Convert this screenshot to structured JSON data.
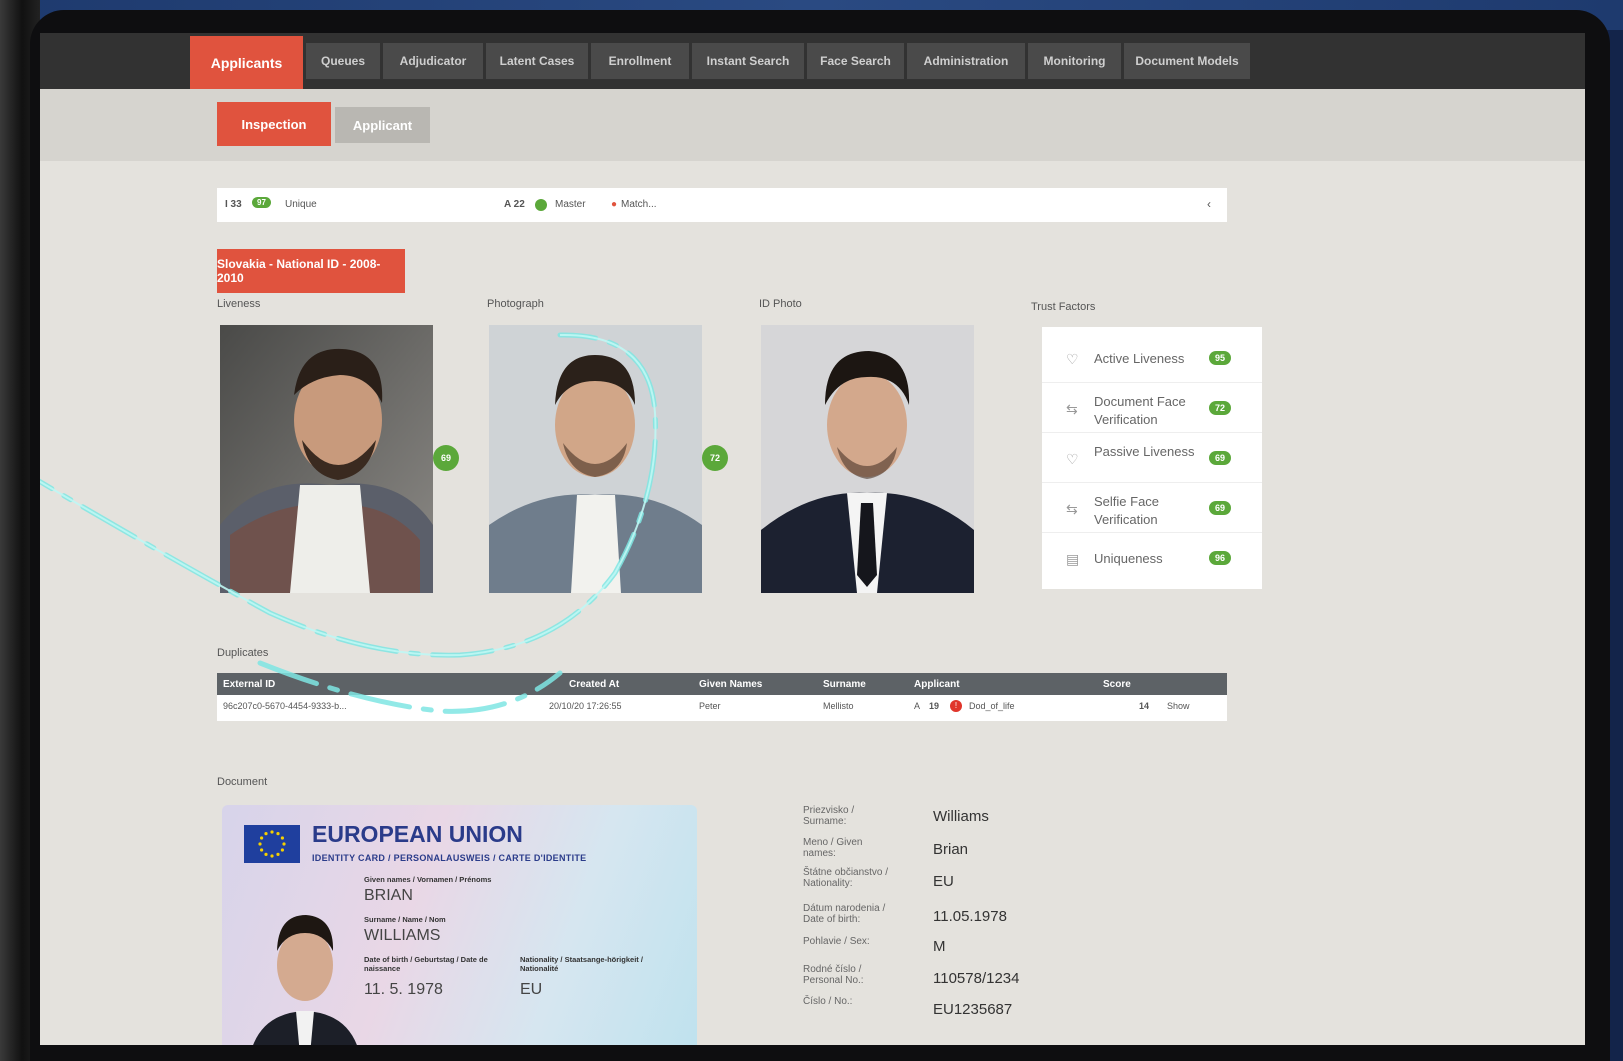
{
  "nav": {
    "tabs": [
      {
        "label": "Applicants",
        "active": true
      },
      {
        "label": "Queues",
        "active": false
      },
      {
        "label": "Adjudicator",
        "active": false
      },
      {
        "label": "Latent Cases",
        "active": false
      },
      {
        "label": "Enrollment",
        "active": false
      },
      {
        "label": "Instant Search",
        "active": false
      },
      {
        "label": "Face Search",
        "active": false
      },
      {
        "label": "Administration",
        "active": false
      },
      {
        "label": "Monitoring",
        "active": false
      },
      {
        "label": "Document Models",
        "active": false
      }
    ]
  },
  "subnav": {
    "inspection_label": "Inspection",
    "applicant_label": "Applicant"
  },
  "summary": {
    "left_count": "I 33",
    "left_badge": "97",
    "left_label": "Unique",
    "mid_count": "A 22",
    "mid_label": "Master",
    "match_label": "Match...",
    "chevron": "‹"
  },
  "document_tag": "Slovakia - National ID - 2008-2010",
  "labels": {
    "liveness": "Liveness",
    "photograph": "Photograph",
    "id_photo": "ID Photo",
    "trust_factors": "Trust Factors",
    "duplicates": "Duplicates",
    "document": "Document"
  },
  "scores": {
    "liveness_to_photo": "69",
    "photo_to_id": "72"
  },
  "trust_factors": [
    {
      "label": "Active Liveness",
      "score": "95",
      "icon": "heart-icon"
    },
    {
      "label": "Document Face Verification",
      "score": "72",
      "icon": "face-compare-icon"
    },
    {
      "label": "Passive Liveness",
      "score": "69",
      "icon": "heart-icon"
    },
    {
      "label": "Selfie Face Verification",
      "score": "69",
      "icon": "face-compare-icon"
    },
    {
      "label": "Uniqueness",
      "score": "96",
      "icon": "unique-icon"
    }
  ],
  "duplicates": {
    "columns": [
      "External ID",
      "Created At",
      "Given Names",
      "Surname",
      "Applicant",
      "Score"
    ],
    "rows": [
      {
        "external_id": "96c207c0-5670-4454-9333-b...",
        "created_at": "20/10/20 17:26:55",
        "given_names": "Peter",
        "surname": "Mellisto",
        "applicant_prefix": "A",
        "applicant_num": "19",
        "applicant_flag": "!",
        "applicant_name": "Dod_of_life",
        "score": "14",
        "action": "Show"
      }
    ]
  },
  "id_card": {
    "title": "EUROPEAN UNION",
    "subtitle": "IDENTITY CARD / PERSONALAUSWEIS / CARTE D'IDENTITE",
    "given_label": "Given names / Vornamen / Prénoms",
    "given_value": "BRIAN",
    "surname_label": "Surname / Name / Nom",
    "surname_value": "WILLIAMS",
    "dob_label": "Date of birth / Geburtstag / Date de naissance",
    "dob_value": "11. 5. 1978",
    "nat_label": "Nationality / Staatsange-hörigkeit / Nationalité",
    "nat_value": "EU"
  },
  "document_fields": [
    {
      "label": "Priezvisko / Surname:",
      "value": "Williams"
    },
    {
      "label": "Meno / Given names:",
      "value": "Brian"
    },
    {
      "label": "Štátne občianstvo / Nationality:",
      "value": "EU"
    },
    {
      "label": "Dátum narodenia / Date of birth:",
      "value": "11.05.1978"
    },
    {
      "label": "Pohlavie / Sex:",
      "value": "M"
    },
    {
      "label": "Rodné číslo / Personal No.:",
      "value": "110578/1234"
    },
    {
      "label": "Číslo / No.:",
      "value": "EU1235687"
    }
  ],
  "colors": {
    "accent": "#e0533e",
    "success": "#5ba83a",
    "nav_bg": "#323232"
  }
}
